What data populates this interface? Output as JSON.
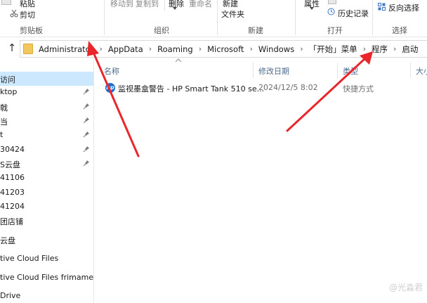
{
  "ribbon": {
    "paste_label": "粘贴",
    "cut_label": "剪切",
    "move_to_label": "移动到",
    "copy_to_label": "复制到",
    "delete_label": "删除",
    "rename_label": "重命名",
    "new_label": "新建",
    "new_folder_label": "文件夹",
    "properties_label": "属性",
    "history_label": "历史记录",
    "invert_selection_label": "反向选择",
    "groups": {
      "clipboard": "剪贴板",
      "organize": "组织",
      "new": "新建",
      "open": "打开",
      "select": "选择"
    }
  },
  "address": {
    "crumbs": [
      "Administrator",
      "AppData",
      "Roaming",
      "Microsoft",
      "Windows",
      "「开始」菜单",
      "程序",
      "启动"
    ]
  },
  "nav": {
    "items": [
      {
        "label": "访问",
        "pinned": false,
        "selected": true
      },
      {
        "label": "ktop",
        "pinned": true,
        "selected": false
      },
      {
        "label": "戟",
        "pinned": true,
        "selected": false
      },
      {
        "label": "当",
        "pinned": true,
        "selected": false
      },
      {
        "label": "t",
        "pinned": true,
        "selected": false
      },
      {
        "label": "30424",
        "pinned": true,
        "selected": false
      },
      {
        "label": "S云盘",
        "pinned": true,
        "selected": false
      },
      {
        "label": "41106",
        "pinned": false,
        "selected": false
      },
      {
        "label": "41203",
        "pinned": false,
        "selected": false
      },
      {
        "label": "41204",
        "pinned": false,
        "selected": false
      },
      {
        "label": "团店铺",
        "pinned": false,
        "selected": false
      },
      {
        "label": "云盘",
        "pinned": false,
        "selected": false
      },
      {
        "label": "tive Cloud Files",
        "pinned": false,
        "selected": false
      },
      {
        "label": "tive Cloud Files  frimamentC",
        "pinned": false,
        "selected": false
      },
      {
        "label": "Drive",
        "pinned": false,
        "selected": false
      }
    ]
  },
  "columns": {
    "name": "名称",
    "date": "修改日期",
    "type": "类型",
    "size": "大小"
  },
  "files": [
    {
      "name": "监视墨盒警告 - HP Smart Tank 510 se...",
      "date": "2024/12/5 8:02",
      "type": "快捷方式",
      "icon": "hp-icon"
    }
  ],
  "watermark": "@光淼君",
  "colors": {
    "arrow": "#e8262b",
    "selection": "#cce8ff",
    "folder": "#f2c75c"
  }
}
